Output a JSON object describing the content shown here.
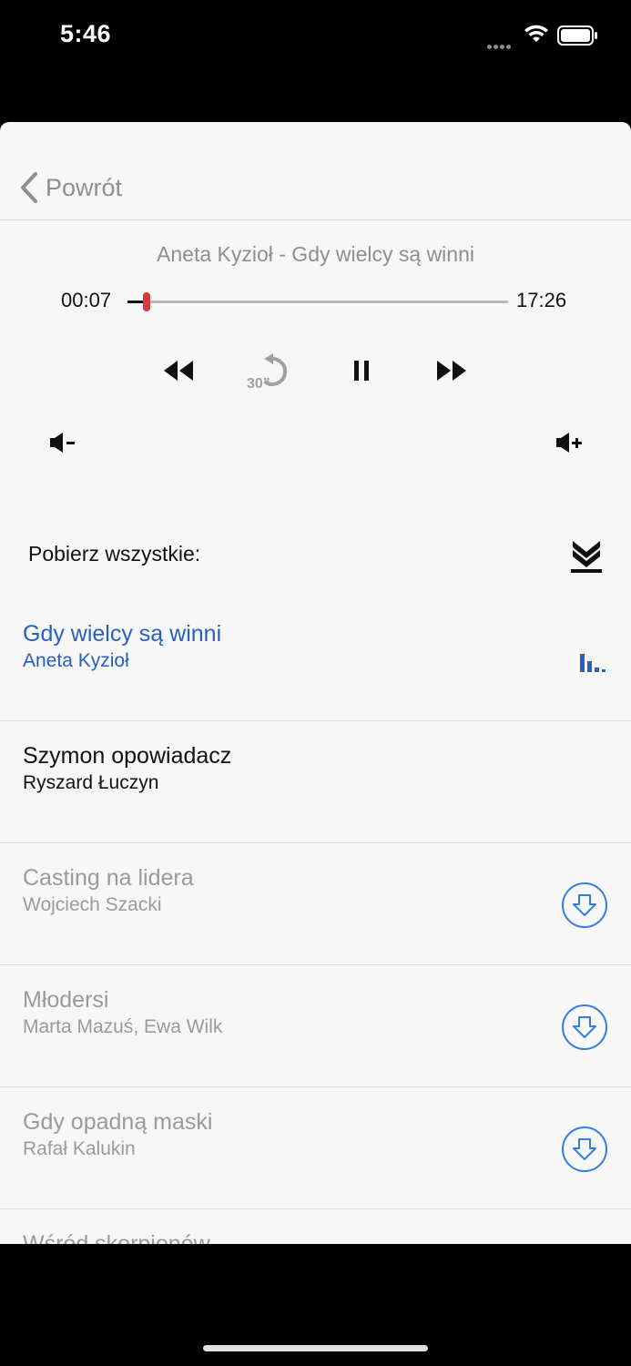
{
  "status_bar": {
    "time": "5:46"
  },
  "nav": {
    "back_label": "Powrót"
  },
  "player": {
    "track_title": "Aneta Kyzioł - Gdy wielcy są winni",
    "elapsed": "00:07",
    "total": "17:26",
    "progress_fraction": 0.007,
    "replay_label": "30”"
  },
  "download_all": {
    "label": "Pobierz wszystkie:"
  },
  "episodes": [
    {
      "title": "Gdy wielcy są winni",
      "author": "Aneta Kyzioł",
      "state": "playing"
    },
    {
      "title": "Szymon opowiadacz",
      "author": "Ryszard Łuczyn",
      "state": "downloaded"
    },
    {
      "title": "Casting na lidera",
      "author": "Wojciech Szacki",
      "state": "not-downloaded"
    },
    {
      "title": "Młodersi",
      "author": "Marta Mazuś, Ewa Wilk",
      "state": "not-downloaded"
    },
    {
      "title": "Gdy opadną maski",
      "author": "Rafał Kalukin",
      "state": "not-downloaded"
    },
    {
      "title": "Wśród skorpionów",
      "author": "",
      "state": "not-downloaded"
    }
  ],
  "colors": {
    "accent": "#2660c0",
    "thumb": "#d43a3a",
    "download_icon": "#2f7fe0",
    "muted_text": "#9a9a9a"
  },
  "icons": {
    "back": "chevron-left-icon",
    "rewind": "rewind-icon",
    "replay": "replay-30-icon",
    "pause": "pause-icon",
    "forward": "fast-forward-icon",
    "volume_down": "volume-down-icon",
    "volume_up": "volume-up-icon",
    "download_all": "download-all-icon",
    "download": "download-circle-icon",
    "playing": "equalizer-icon"
  }
}
